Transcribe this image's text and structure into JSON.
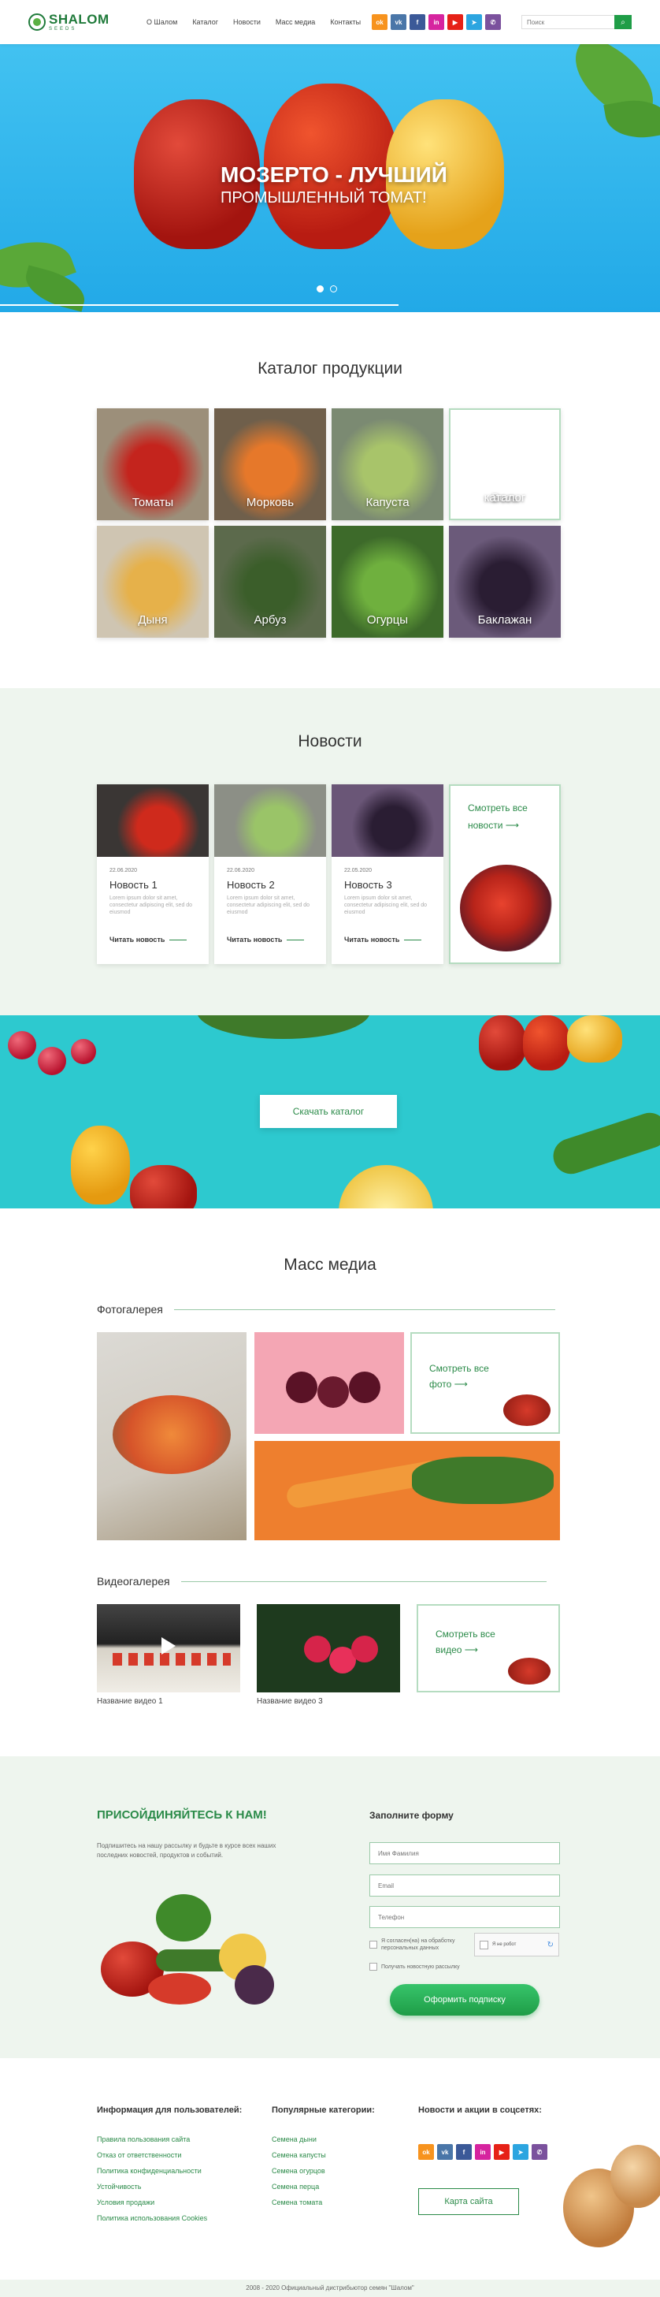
{
  "header": {
    "logo_name": "SHALOM",
    "logo_sub": "SEEDS",
    "nav": [
      "О Шалом",
      "Каталог",
      "Новости",
      "Масс медиа",
      "Контакты"
    ],
    "search_placeholder": "Поиск",
    "socials": [
      {
        "name": "ok-icon",
        "label": "ok",
        "color": "#f7931e"
      },
      {
        "name": "vk-icon",
        "label": "vk",
        "color": "#4a76a8"
      },
      {
        "name": "facebook-icon",
        "label": "f",
        "color": "#3b5998"
      },
      {
        "name": "instagram-icon",
        "label": "in",
        "color": "#d6249f"
      },
      {
        "name": "youtube-icon",
        "label": "▶",
        "color": "#e62117"
      },
      {
        "name": "telegram-icon",
        "label": "➤",
        "color": "#2ca5e0"
      },
      {
        "name": "viber-icon",
        "label": "✆",
        "color": "#7b519d"
      }
    ]
  },
  "hero": {
    "title": "МОЗЕРТО - ЛУЧШИЙ",
    "subtitle": "ПРОМЫШЛЕННЫЙ ТОМАТ!",
    "active_slide": 1,
    "slide_count": 2
  },
  "catalog": {
    "title": "Каталог продукции",
    "all_label_line1": "Весь",
    "all_label_line2": "каталог",
    "items": [
      {
        "label": "Томаты",
        "bg": "#9c8f7a",
        "fg": "#c4241d"
      },
      {
        "label": "Морковь",
        "bg": "#6f5f4b",
        "fg": "#e6782a"
      },
      {
        "label": "Капуста",
        "bg": "#7b8a72",
        "fg": "#a8c46a"
      },
      {
        "label": "Дыня",
        "bg": "#cfc5b2",
        "fg": "#e6b14a"
      },
      {
        "label": "Арбуз",
        "bg": "#5c6a4c",
        "fg": "#3b5e2a"
      },
      {
        "label": "Огурцы",
        "bg": "#3d6a2a",
        "fg": "#6fb03e"
      },
      {
        "label": "Баклажан",
        "bg": "#6b5a7a",
        "fg": "#2a1d33"
      }
    ]
  },
  "news": {
    "title": "Новости",
    "read_more": "Читать новость",
    "all_line1": "Смотреть все",
    "all_line2": "новости",
    "items": [
      {
        "date": "22.06.2020",
        "title": "Новость 1",
        "text": "Lorem ipsum dolor sit amet, consectetur adipiscing elit, sed do eiusmod",
        "img": "#3a3634",
        "fg": "#cf2a1c"
      },
      {
        "date": "22.06.2020",
        "title": "Новость 2",
        "text": "Lorem ipsum dolor sit amet, consectetur adipiscing elit, sed do eiusmod",
        "img": "#8c8f86",
        "fg": "#9ac468"
      },
      {
        "date": "22.05.2020",
        "title": "Новость 3",
        "text": "Lorem ipsum dolor sit amet, consectetur adipiscing elit, sed do eiusmod",
        "img": "#6a5677",
        "fg": "#2a1d33"
      }
    ]
  },
  "banner": {
    "button": "Скачать каталог"
  },
  "media": {
    "title": "Масс медиа",
    "photo_heading": "Фотогалерея",
    "video_heading": "Видеогалерея",
    "photo_all_line1": "Смотреть все",
    "photo_all_line2": "фото",
    "video_all_line1": "Смотреть все",
    "video_all_line2": "видео",
    "videos": [
      "Название видео 1",
      "Название видео 3"
    ]
  },
  "join": {
    "title": "ПРИСОЙДИНЯЙТЕСЬ К НАМ!",
    "desc": "Подпишитесь на нашу рассылку и будьте в курсе всех наших последних новостей, продуктов и событий.",
    "form_title": "Заполните форму",
    "name_placeholder": "Имя Фамилия",
    "email_placeholder": "Email",
    "phone_placeholder": "Телефон",
    "consent": "Я согласен(на) на обработку персональных данных",
    "newsletter": "Получать новостную рассылку",
    "captcha": "Я не робот",
    "submit": "Оформить подписку"
  },
  "footer": {
    "col1_title": "Информация для пользователей:",
    "col1_links": [
      "Правила пользования сайта",
      "Отказ от ответственности",
      "Политика конфиденциальности",
      "Устойчивость",
      "Условия продажи",
      "Политика использования Cookies"
    ],
    "col2_title": "Популярные категории:",
    "col2_links": [
      "Семена дыни",
      "Семена капусты",
      "Семена огурцов",
      "Семена перца",
      "Семена томата"
    ],
    "col3_title": "Новости и акции в соцсетях:",
    "map_button": "Карта сайта",
    "copyright": "2008 - 2020 Официальный дистрибьютор семян \"Шалом\""
  }
}
